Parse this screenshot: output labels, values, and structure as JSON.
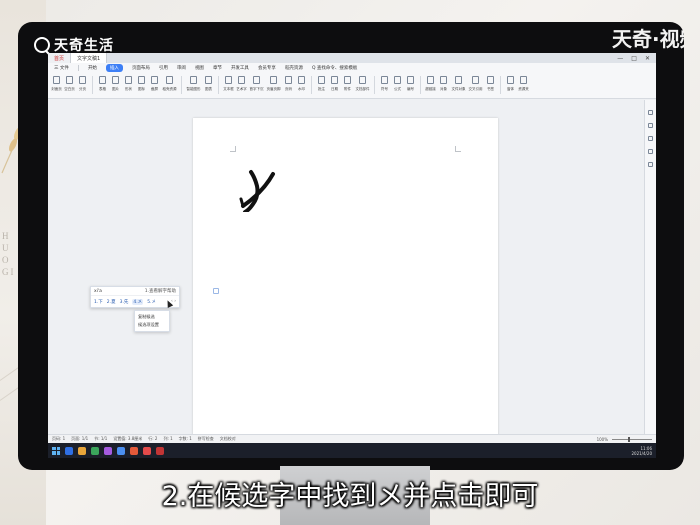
{
  "logo": {
    "text": "天奇生活"
  },
  "watermark": "天奇·视频",
  "caption": "2.在候选字中找到メ并点击即可",
  "titlebar": {
    "home_tab": "首页",
    "doc_tab": "文字文稿1",
    "controls": [
      "—",
      "□",
      "✕"
    ]
  },
  "menubar": {
    "items": [
      "三 文件",
      "开始",
      "插入",
      "页面布局",
      "引用",
      "审阅",
      "视图",
      "章节",
      "开发工具",
      "会员专享",
      "稻壳资源",
      "Q 查找命令、搜索模板"
    ],
    "active_index": 2
  },
  "ribbon": {
    "buttons": [
      "封面页",
      "空白页",
      "分页",
      "表格",
      "图片",
      "形状",
      "图标",
      "截屏",
      "稻壳资源",
      "智能图形",
      "图表",
      "文本框",
      "艺术字",
      "首字下沉",
      "页眉页脚",
      "页码",
      "水印",
      "批注",
      "日期",
      "附件",
      "文档部件",
      "符号",
      "公式",
      "编号",
      "超链接",
      "对象",
      "文件对象",
      "交叉引用",
      "书签",
      "窗体",
      "资源夹"
    ]
  },
  "document": {
    "glyph": "メ"
  },
  "ime": {
    "composition": "xi'a",
    "hint": "1.查看解字帮助",
    "candidates": [
      "1.下",
      "2.夏",
      "3.先",
      "4.メ",
      "5.㐅"
    ],
    "highlight_index": 3,
    "arrows": "‹ ›",
    "menu": [
      "复制候选",
      "候选项设置"
    ]
  },
  "statusbar": {
    "left": [
      "页码: 1",
      "页面: 1/1",
      "节: 1/1",
      "设置值: 3.8厘米",
      "行: 2",
      "列: 1",
      "字数: 1",
      "拼写检查",
      "文档校对"
    ],
    "zoom": "100%"
  },
  "taskbar": {
    "app_colors": [
      "#2f6fe4",
      "#e8a53a",
      "#3ba55c",
      "#a55be0",
      "#4b8ff0",
      "#e45a3a",
      "#e44b4b",
      "#c23535"
    ],
    "clock_time": "11:06",
    "clock_date": "2021/4/20"
  },
  "colors": {
    "accent": "#3d7ff6",
    "taskbar": "#1b1f2a"
  }
}
